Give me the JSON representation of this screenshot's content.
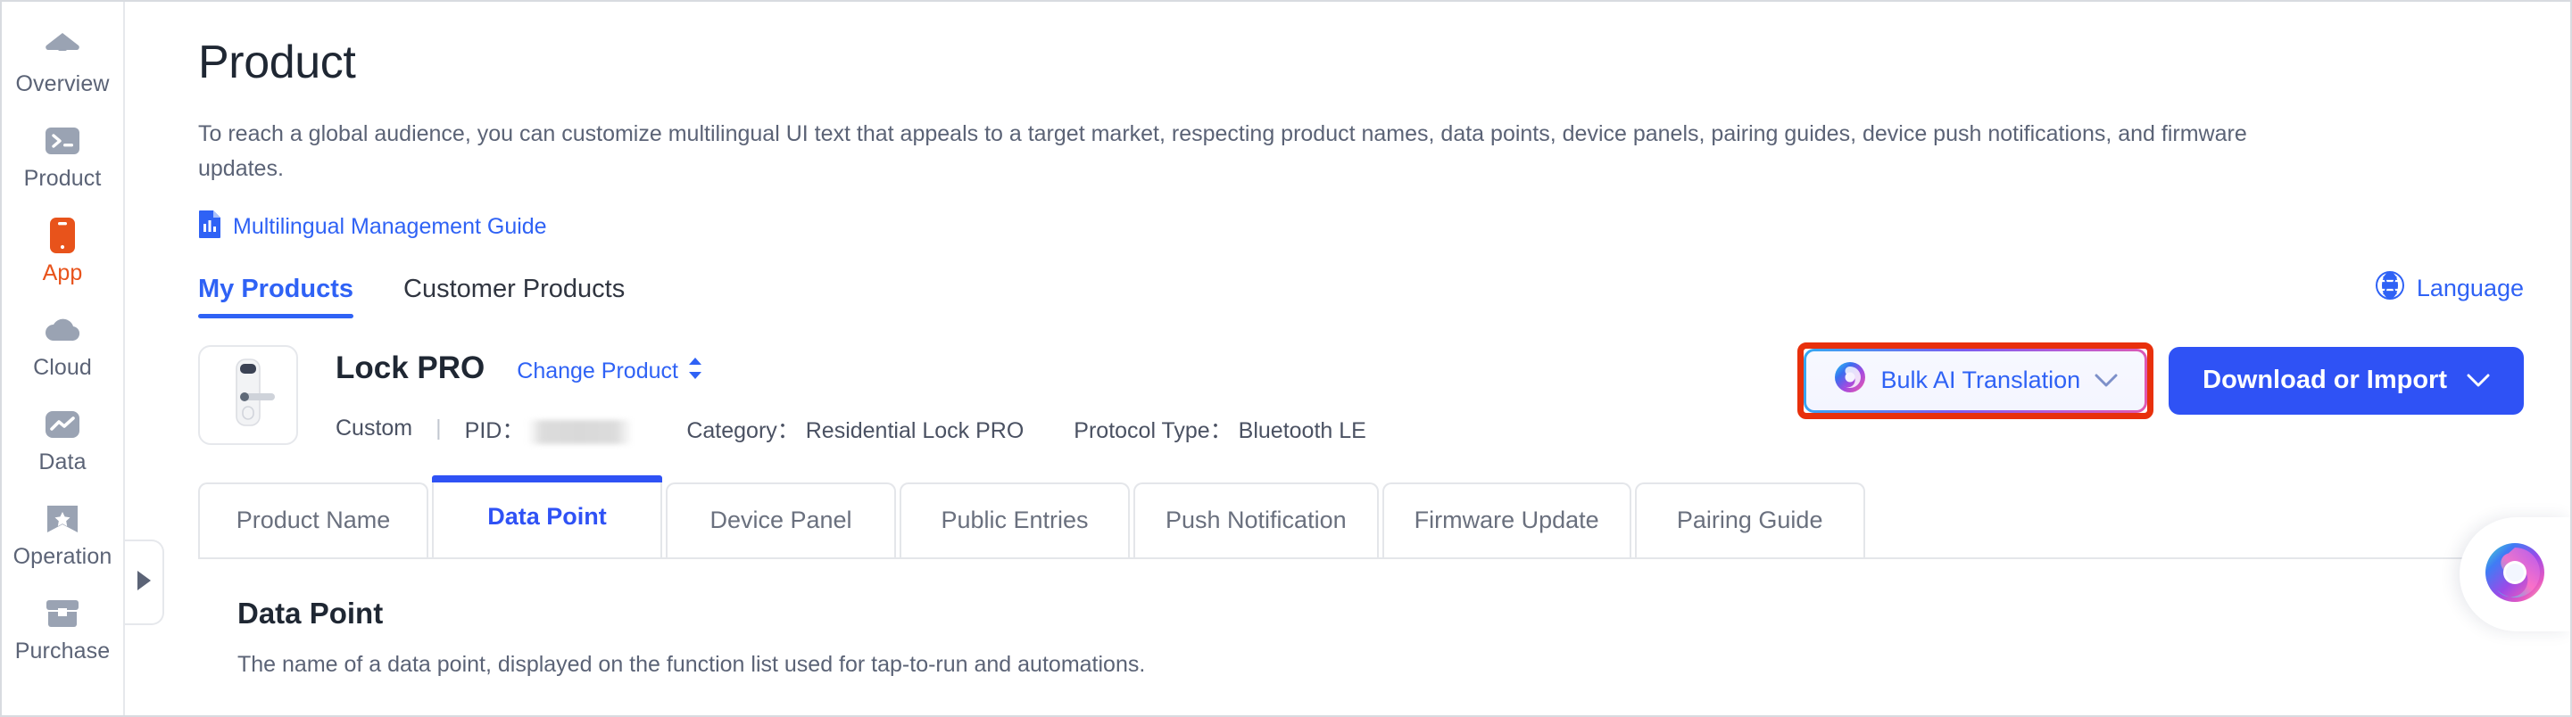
{
  "sidebar": {
    "items": [
      {
        "label": "Overview",
        "icon": "home-icon",
        "active": false
      },
      {
        "label": "Product",
        "icon": "terminal-icon",
        "active": false
      },
      {
        "label": "App",
        "icon": "phone-icon",
        "active": true
      },
      {
        "label": "Cloud",
        "icon": "cloud-icon",
        "active": false
      },
      {
        "label": "Data",
        "icon": "chart-line-icon",
        "active": false
      },
      {
        "label": "Operation",
        "icon": "star-banner-icon",
        "active": false
      },
      {
        "label": "Purchase",
        "icon": "box-icon",
        "active": false
      }
    ],
    "collapse_icon": "chevron-right-icon"
  },
  "header": {
    "title": "Product",
    "description": "To reach a global audience, you can customize multilingual UI text that appeals to a target market, respecting product names, data points, device panels, pairing guides, device push notifications, and firmware updates.",
    "guide_link": "Multilingual Management Guide",
    "guide_icon": "document-icon"
  },
  "segment_tabs": [
    {
      "label": "My Products",
      "active": true
    },
    {
      "label": "Customer Products",
      "active": false
    }
  ],
  "language_button": {
    "label": "Language",
    "icon": "globe-icon"
  },
  "product": {
    "thumbnail_icon": "smart-door-lock-image",
    "name": "Lock PRO",
    "change_product_label": "Change Product",
    "change_product_icon": "up-down-arrow-icon",
    "meta": {
      "type": "Custom",
      "separator": "|",
      "pid_key": "PID：",
      "pid_value": "",
      "category_key": "Category：",
      "category_value": "Residential Lock PRO",
      "protocol_key": "Protocol Type：",
      "protocol_value": "Bluetooth LE"
    }
  },
  "actions": {
    "bulk_ai_translation": {
      "label": "Bulk AI Translation",
      "icon": "ai-swirl-icon",
      "chevron": "chevron-down-icon",
      "highlighted": true,
      "highlight_color": "#e8300c"
    },
    "download_or_import": {
      "label": "Download or Import",
      "chevron": "chevron-down-icon",
      "color": "#2f52f5"
    }
  },
  "card_tabs": [
    {
      "label": "Product Name",
      "active": false
    },
    {
      "label": "Data Point",
      "active": true
    },
    {
      "label": "Device Panel",
      "active": false
    },
    {
      "label": "Public Entries",
      "active": false
    },
    {
      "label": "Push Notification",
      "active": false
    },
    {
      "label": "Firmware Update",
      "active": false
    },
    {
      "label": "Pairing Guide",
      "active": false
    }
  ],
  "panel": {
    "title": "Data Point",
    "description": "The name of a data point, displayed on the function list used for tap-to-run and automations."
  },
  "assistant": {
    "icon": "ai-assistant-swirl-icon"
  },
  "colors": {
    "accent_blue": "#2f52f5",
    "link_blue": "#2f62f5",
    "active_orange": "#e8531b",
    "muted_gray": "#9aa3b3"
  }
}
